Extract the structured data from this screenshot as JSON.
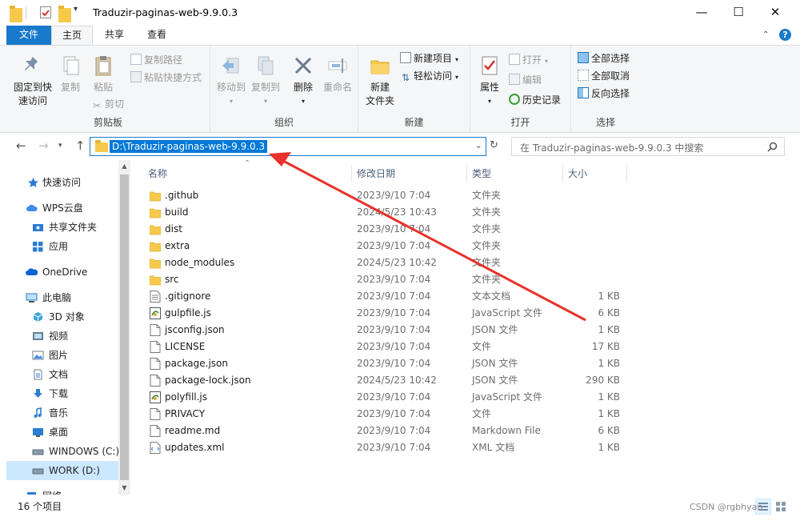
{
  "window": {
    "title": "Traduzir-paginas-web-9.9.0.3",
    "minimize": "—",
    "maximize": "☐",
    "close": "✕"
  },
  "tabs": {
    "file": "文件",
    "home": "主页",
    "share": "共享",
    "view": "查看"
  },
  "ribbon": {
    "clipboard": {
      "label": "剪贴板",
      "pin": "固定到快\n速访问",
      "pin_l1": "固定到快",
      "pin_l2": "速访问",
      "copy": "复制",
      "paste": "粘贴",
      "copy_path": "复制路径",
      "paste_shortcut": "粘贴快捷方式",
      "cut": "剪切"
    },
    "organize": {
      "label": "组织",
      "move_to": "移动到",
      "copy_to": "复制到",
      "delete": "删除",
      "rename": "重命名"
    },
    "new": {
      "label": "新建",
      "new_folder_l1": "新建",
      "new_folder_l2": "文件夹",
      "new_item": "新建项目",
      "easy_access": "轻松访问"
    },
    "open": {
      "label": "打开",
      "properties": "属性",
      "open": "打开",
      "edit": "编辑",
      "history": "历史记录"
    },
    "select": {
      "label": "选择",
      "select_all": "全部选择",
      "select_none": "全部取消",
      "invert": "反向选择"
    }
  },
  "address": {
    "path": "D:\\Traduzir-paginas-web-9.9.0.3",
    "search_placeholder": "在 Traduzir-paginas-web-9.9.0.3 中搜索"
  },
  "nav": {
    "items": [
      {
        "label": "快速访问",
        "icon": "star-icon"
      },
      {
        "label": "WPS云盘",
        "icon": "cloud-icon"
      },
      {
        "label": "共享文件夹",
        "icon": "shared-folder-icon"
      },
      {
        "label": "应用",
        "icon": "apps-icon"
      },
      {
        "label": "OneDrive",
        "icon": "onedrive-icon"
      },
      {
        "label": "此电脑",
        "icon": "computer-icon"
      },
      {
        "label": "3D 对象",
        "icon": "cube-icon"
      },
      {
        "label": "视频",
        "icon": "video-icon"
      },
      {
        "label": "图片",
        "icon": "picture-icon"
      },
      {
        "label": "文档",
        "icon": "document-icon"
      },
      {
        "label": "下载",
        "icon": "download-icon"
      },
      {
        "label": "音乐",
        "icon": "music-icon"
      },
      {
        "label": "桌面",
        "icon": "desktop-icon"
      },
      {
        "label": "WINDOWS (C:)",
        "icon": "drive-icon"
      },
      {
        "label": "WORK (D:)",
        "icon": "drive-icon"
      },
      {
        "label": "网络",
        "icon": "network-icon"
      }
    ]
  },
  "columns": {
    "name": "名称",
    "date": "修改日期",
    "type": "类型",
    "size": "大小"
  },
  "files": [
    {
      "name": ".github",
      "date": "2023/9/10 7:04",
      "type": "文件夹",
      "size": "",
      "kind": "folder"
    },
    {
      "name": "build",
      "date": "2024/5/23 10:43",
      "type": "文件夹",
      "size": "",
      "kind": "folder"
    },
    {
      "name": "dist",
      "date": "2023/9/10 7:04",
      "type": "文件夹",
      "size": "",
      "kind": "folder"
    },
    {
      "name": "extra",
      "date": "2023/9/10 7:04",
      "type": "文件夹",
      "size": "",
      "kind": "folder"
    },
    {
      "name": "node_modules",
      "date": "2024/5/23 10:42",
      "type": "文件夹",
      "size": "",
      "kind": "folder"
    },
    {
      "name": "src",
      "date": "2023/9/10 7:04",
      "type": "文件夹",
      "size": "",
      "kind": "folder"
    },
    {
      "name": ".gitignore",
      "date": "2023/9/10 7:04",
      "type": "文本文档",
      "size": "1 KB",
      "kind": "text"
    },
    {
      "name": "gulpfile.js",
      "date": "2023/9/10 7:04",
      "type": "JavaScript 文件",
      "size": "6 KB",
      "kind": "js"
    },
    {
      "name": "jsconfig.json",
      "date": "2023/9/10 7:04",
      "type": "JSON 文件",
      "size": "1 KB",
      "kind": "file"
    },
    {
      "name": "LICENSE",
      "date": "2023/9/10 7:04",
      "type": "文件",
      "size": "17 KB",
      "kind": "file"
    },
    {
      "name": "package.json",
      "date": "2023/9/10 7:04",
      "type": "JSON 文件",
      "size": "1 KB",
      "kind": "file"
    },
    {
      "name": "package-lock.json",
      "date": "2024/5/23 10:42",
      "type": "JSON 文件",
      "size": "290 KB",
      "kind": "file"
    },
    {
      "name": "polyfill.js",
      "date": "2023/9/10 7:04",
      "type": "JavaScript 文件",
      "size": "1 KB",
      "kind": "js"
    },
    {
      "name": "PRIVACY",
      "date": "2023/9/10 7:04",
      "type": "文件",
      "size": "1 KB",
      "kind": "file"
    },
    {
      "name": "readme.md",
      "date": "2023/9/10 7:04",
      "type": "Markdown File",
      "size": "6 KB",
      "kind": "file"
    },
    {
      "name": "updates.xml",
      "date": "2023/9/10 7:04",
      "type": "XML 文档",
      "size": "1 KB",
      "kind": "xml"
    }
  ],
  "status": {
    "count": "16 个项目"
  },
  "watermark": "CSDN @rgbhyan",
  "colors": {
    "accent": "#1979ca",
    "selection": "#0078d7",
    "folder": "#f7c94b",
    "annotation_arrow": "#e8312a"
  }
}
